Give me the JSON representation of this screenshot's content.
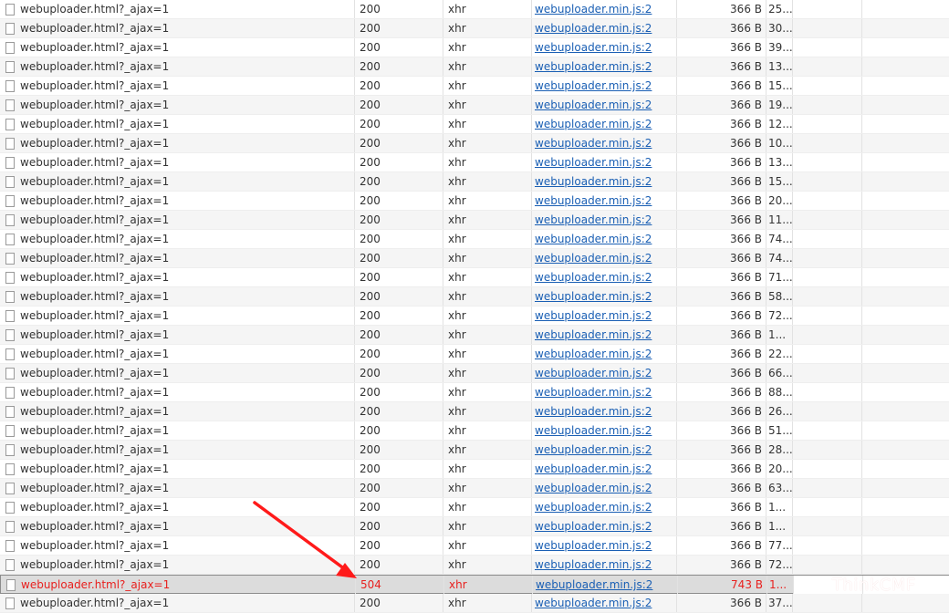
{
  "requests": [
    {
      "name": "webuploader.html?_ajax=1",
      "status": "200",
      "type": "xhr",
      "initiator": "webuploader.min.js:2",
      "size": "366 B",
      "time": "25..."
    },
    {
      "name": "webuploader.html?_ajax=1",
      "status": "200",
      "type": "xhr",
      "initiator": "webuploader.min.js:2",
      "size": "366 B",
      "time": "30..."
    },
    {
      "name": "webuploader.html?_ajax=1",
      "status": "200",
      "type": "xhr",
      "initiator": "webuploader.min.js:2",
      "size": "366 B",
      "time": "39..."
    },
    {
      "name": "webuploader.html?_ajax=1",
      "status": "200",
      "type": "xhr",
      "initiator": "webuploader.min.js:2",
      "size": "366 B",
      "time": "13..."
    },
    {
      "name": "webuploader.html?_ajax=1",
      "status": "200",
      "type": "xhr",
      "initiator": "webuploader.min.js:2",
      "size": "366 B",
      "time": "15..."
    },
    {
      "name": "webuploader.html?_ajax=1",
      "status": "200",
      "type": "xhr",
      "initiator": "webuploader.min.js:2",
      "size": "366 B",
      "time": "19..."
    },
    {
      "name": "webuploader.html?_ajax=1",
      "status": "200",
      "type": "xhr",
      "initiator": "webuploader.min.js:2",
      "size": "366 B",
      "time": "12..."
    },
    {
      "name": "webuploader.html?_ajax=1",
      "status": "200",
      "type": "xhr",
      "initiator": "webuploader.min.js:2",
      "size": "366 B",
      "time": "10..."
    },
    {
      "name": "webuploader.html?_ajax=1",
      "status": "200",
      "type": "xhr",
      "initiator": "webuploader.min.js:2",
      "size": "366 B",
      "time": "13..."
    },
    {
      "name": "webuploader.html?_ajax=1",
      "status": "200",
      "type": "xhr",
      "initiator": "webuploader.min.js:2",
      "size": "366 B",
      "time": "15..."
    },
    {
      "name": "webuploader.html?_ajax=1",
      "status": "200",
      "type": "xhr",
      "initiator": "webuploader.min.js:2",
      "size": "366 B",
      "time": "20..."
    },
    {
      "name": "webuploader.html?_ajax=1",
      "status": "200",
      "type": "xhr",
      "initiator": "webuploader.min.js:2",
      "size": "366 B",
      "time": "11..."
    },
    {
      "name": "webuploader.html?_ajax=1",
      "status": "200",
      "type": "xhr",
      "initiator": "webuploader.min.js:2",
      "size": "366 B",
      "time": "74..."
    },
    {
      "name": "webuploader.html?_ajax=1",
      "status": "200",
      "type": "xhr",
      "initiator": "webuploader.min.js:2",
      "size": "366 B",
      "time": "74..."
    },
    {
      "name": "webuploader.html?_ajax=1",
      "status": "200",
      "type": "xhr",
      "initiator": "webuploader.min.js:2",
      "size": "366 B",
      "time": "71..."
    },
    {
      "name": "webuploader.html?_ajax=1",
      "status": "200",
      "type": "xhr",
      "initiator": "webuploader.min.js:2",
      "size": "366 B",
      "time": "58..."
    },
    {
      "name": "webuploader.html?_ajax=1",
      "status": "200",
      "type": "xhr",
      "initiator": "webuploader.min.js:2",
      "size": "366 B",
      "time": "72..."
    },
    {
      "name": "webuploader.html?_ajax=1",
      "status": "200",
      "type": "xhr",
      "initiator": "webuploader.min.js:2",
      "size": "366 B",
      "time": "1..."
    },
    {
      "name": "webuploader.html?_ajax=1",
      "status": "200",
      "type": "xhr",
      "initiator": "webuploader.min.js:2",
      "size": "366 B",
      "time": "22..."
    },
    {
      "name": "webuploader.html?_ajax=1",
      "status": "200",
      "type": "xhr",
      "initiator": "webuploader.min.js:2",
      "size": "366 B",
      "time": "66..."
    },
    {
      "name": "webuploader.html?_ajax=1",
      "status": "200",
      "type": "xhr",
      "initiator": "webuploader.min.js:2",
      "size": "366 B",
      "time": "88..."
    },
    {
      "name": "webuploader.html?_ajax=1",
      "status": "200",
      "type": "xhr",
      "initiator": "webuploader.min.js:2",
      "size": "366 B",
      "time": "26..."
    },
    {
      "name": "webuploader.html?_ajax=1",
      "status": "200",
      "type": "xhr",
      "initiator": "webuploader.min.js:2",
      "size": "366 B",
      "time": "51..."
    },
    {
      "name": "webuploader.html?_ajax=1",
      "status": "200",
      "type": "xhr",
      "initiator": "webuploader.min.js:2",
      "size": "366 B",
      "time": "28..."
    },
    {
      "name": "webuploader.html?_ajax=1",
      "status": "200",
      "type": "xhr",
      "initiator": "webuploader.min.js:2",
      "size": "366 B",
      "time": "20..."
    },
    {
      "name": "webuploader.html?_ajax=1",
      "status": "200",
      "type": "xhr",
      "initiator": "webuploader.min.js:2",
      "size": "366 B",
      "time": "63..."
    },
    {
      "name": "webuploader.html?_ajax=1",
      "status": "200",
      "type": "xhr",
      "initiator": "webuploader.min.js:2",
      "size": "366 B",
      "time": "1..."
    },
    {
      "name": "webuploader.html?_ajax=1",
      "status": "200",
      "type": "xhr",
      "initiator": "webuploader.min.js:2",
      "size": "366 B",
      "time": "1..."
    },
    {
      "name": "webuploader.html?_ajax=1",
      "status": "200",
      "type": "xhr",
      "initiator": "webuploader.min.js:2",
      "size": "366 B",
      "time": "77..."
    },
    {
      "name": "webuploader.html?_ajax=1",
      "status": "200",
      "type": "xhr",
      "initiator": "webuploader.min.js:2",
      "size": "366 B",
      "time": "72..."
    },
    {
      "name": "webuploader.html?_ajax=1",
      "status": "504",
      "type": "xhr",
      "initiator": "webuploader.min.js:2",
      "size": "743 B",
      "time": "1...",
      "error": true
    },
    {
      "name": "webuploader.html?_ajax=1",
      "status": "200",
      "type": "xhr",
      "initiator": "webuploader.min.js:2",
      "size": "366 B",
      "time": "37..."
    }
  ],
  "watermark": "ThinkCMF",
  "colors": {
    "error_text": "#e8201e",
    "annotation_arrow": "#ff1a1a",
    "link": "#1a5fb4",
    "selected_row_bg": "#dcdcdc"
  },
  "icons": {
    "row_icon": "document-icon",
    "annotation": "red-arrow"
  }
}
